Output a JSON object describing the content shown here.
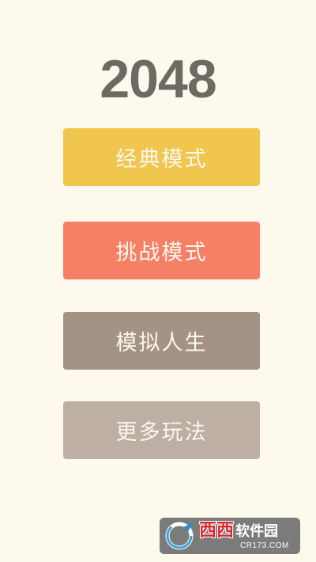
{
  "game": {
    "title": "2048"
  },
  "menu": {
    "classic_label": "经典模式",
    "challenge_label": "挑战模式",
    "life_sim_label": "模拟人生",
    "more_games_label": "更多玩法"
  },
  "watermark": {
    "brand": "西西",
    "name": "软件园",
    "domain": "CR173.COM"
  },
  "colors": {
    "background": "#fdf9ed",
    "title": "#6e6962",
    "classic": "#f0c64f",
    "challenge": "#f58066",
    "life_sim": "#a49284",
    "more_games": "#bdafa4"
  }
}
